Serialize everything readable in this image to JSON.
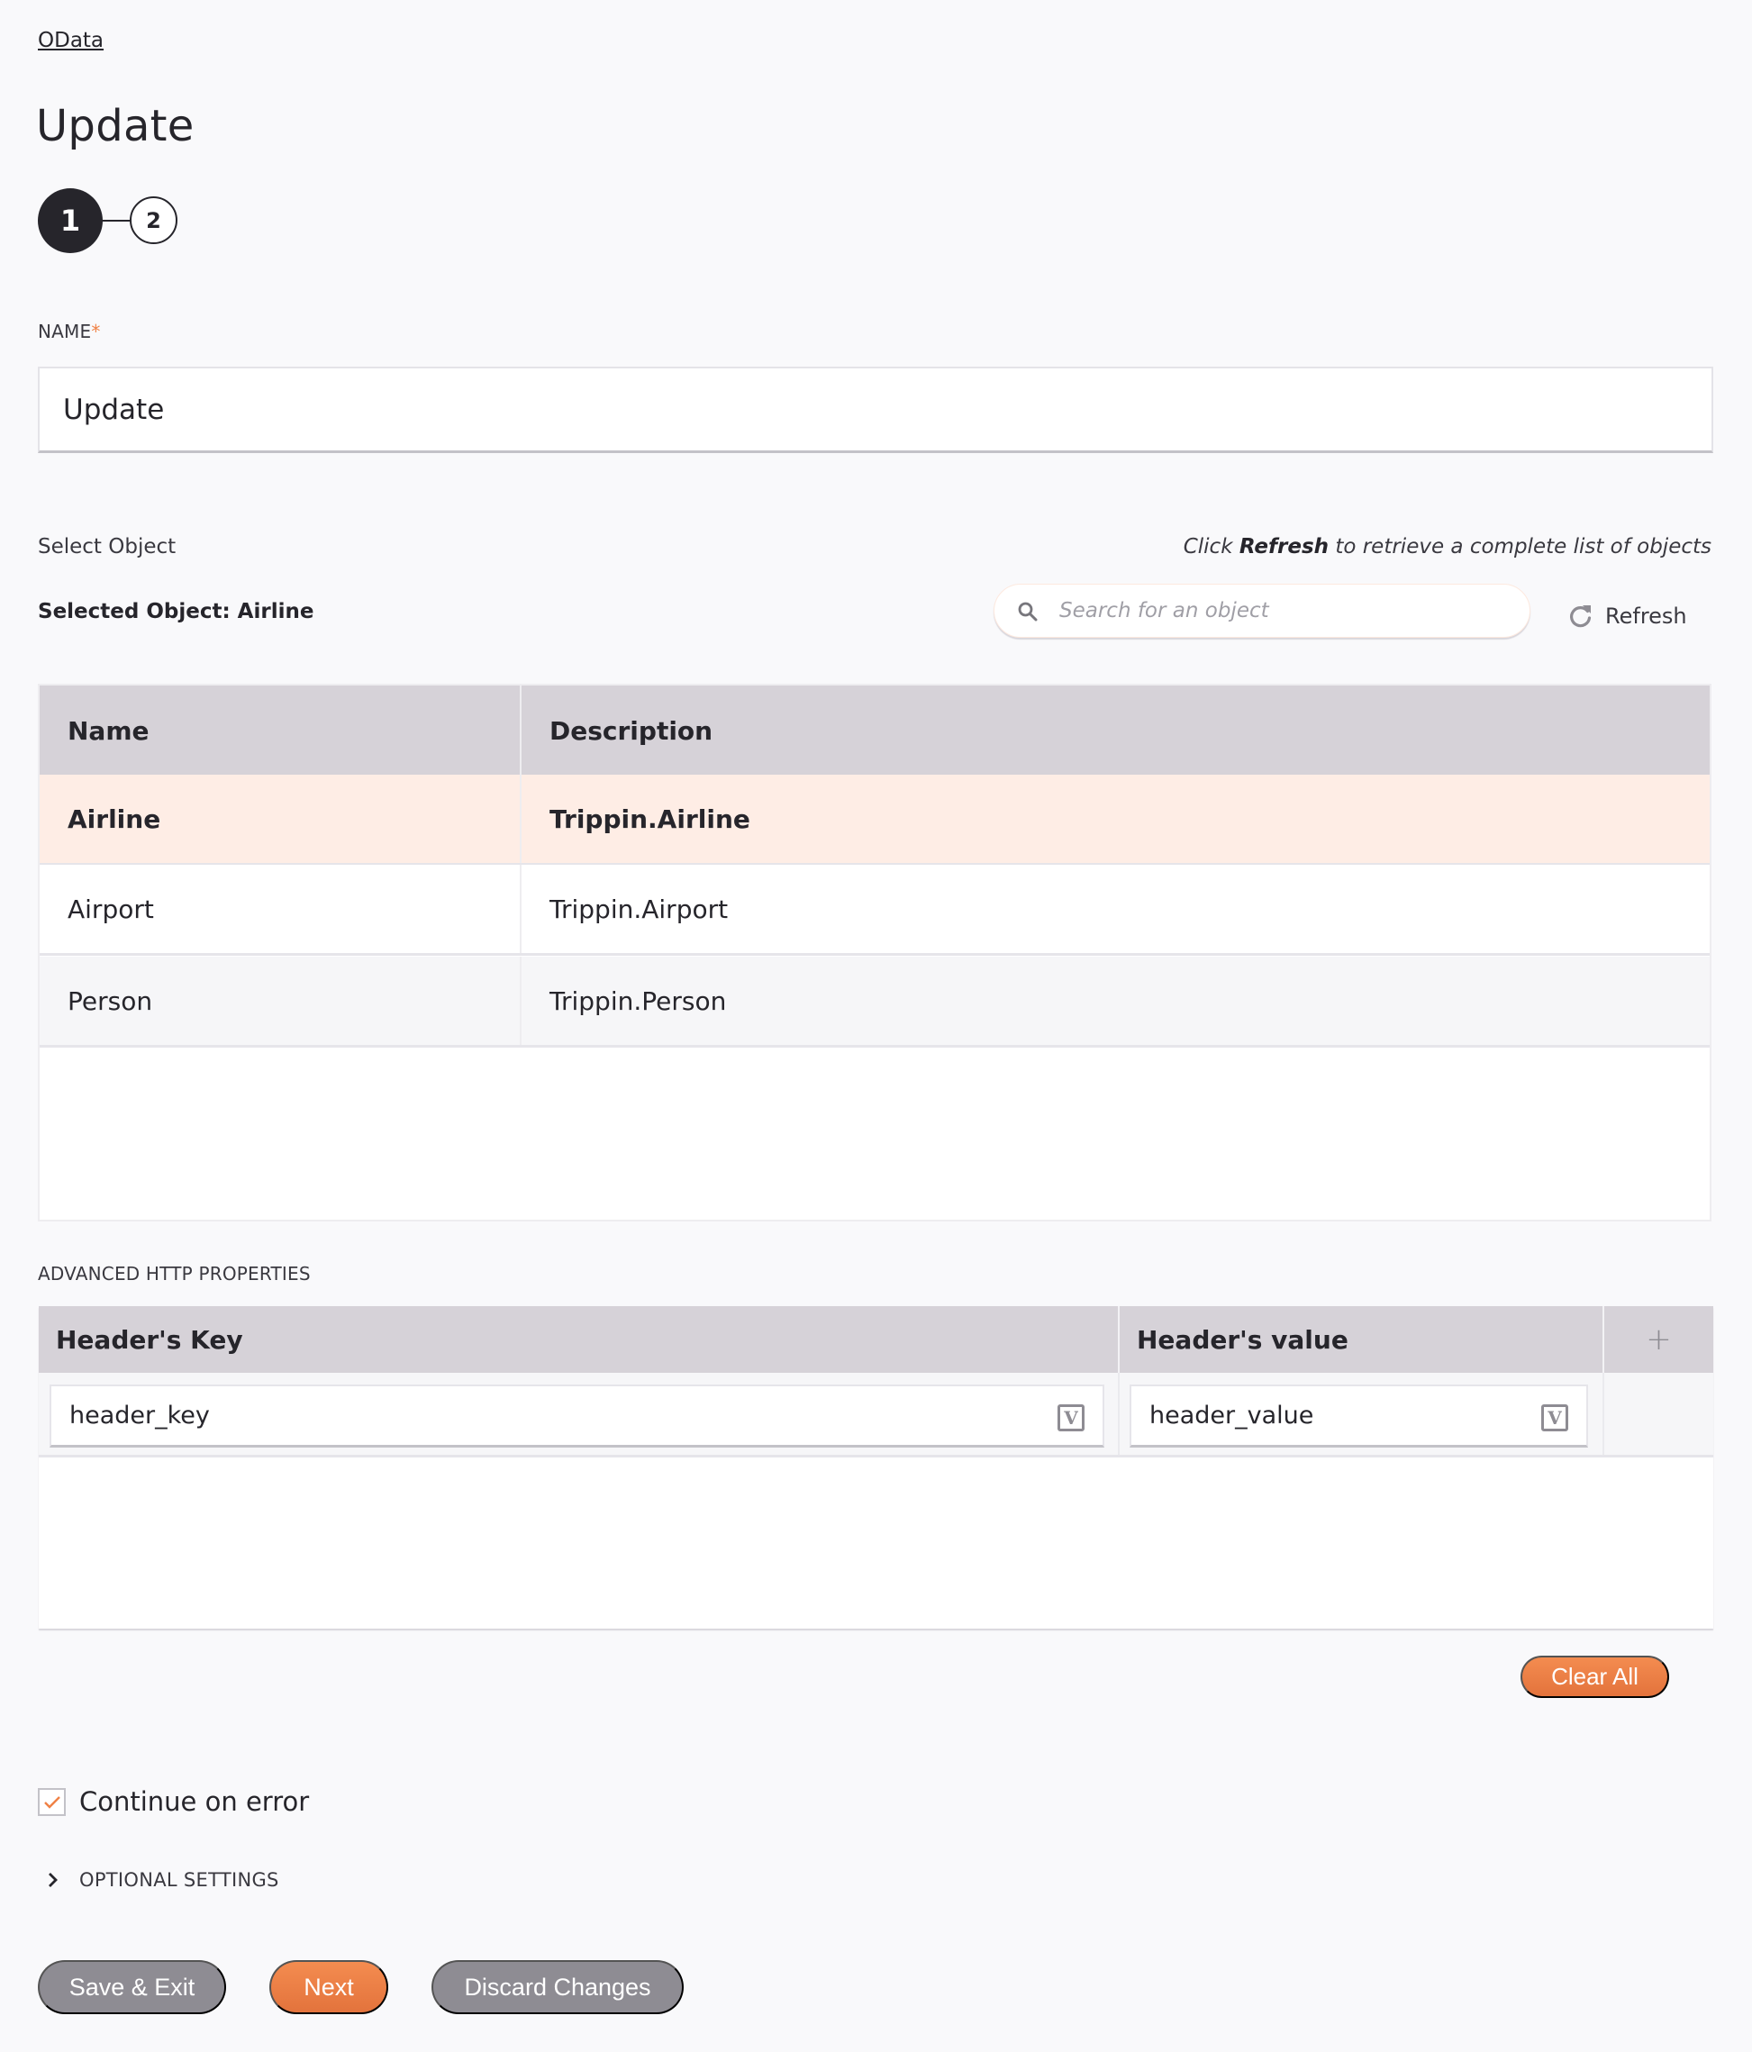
{
  "breadcrumb": "OData",
  "page_title": "Update",
  "stepper": {
    "steps": [
      "1",
      "2"
    ],
    "active_step": 1
  },
  "name_field": {
    "label": "NAME",
    "required_marker": "*",
    "value": "Update"
  },
  "select_object": {
    "label": "Select Object",
    "hint_prefix": "Click ",
    "hint_bold": "Refresh",
    "hint_suffix": " to retrieve a complete list of objects",
    "selected_text": "Selected Object: Airline",
    "search_placeholder": "Search for an object",
    "refresh_label": "Refresh"
  },
  "objects_table": {
    "columns": [
      "Name",
      "Description"
    ],
    "rows": [
      {
        "name": "Airline",
        "description": "Trippin.Airline",
        "selected": true
      },
      {
        "name": "Airport",
        "description": "Trippin.Airport",
        "selected": false
      },
      {
        "name": "Person",
        "description": "Trippin.Person",
        "selected": false
      }
    ]
  },
  "advanced_http": {
    "label": "ADVANCED HTTP PROPERTIES",
    "columns": [
      "Header's Key",
      "Header's value"
    ],
    "add_icon": "+",
    "rows": [
      {
        "key": "header_key",
        "value": "header_value"
      }
    ],
    "variable_icon_glyph": "V",
    "clear_all_label": "Clear All"
  },
  "continue_on_error": {
    "label": "Continue on error",
    "checked": true
  },
  "optional_settings": {
    "label": "OPTIONAL SETTINGS"
  },
  "footer": {
    "save_exit": "Save & Exit",
    "next": "Next",
    "discard": "Discard Changes"
  },
  "colors": {
    "accent": "#f08145",
    "header_bg": "#d6d2d8",
    "selected_row": "#feede5",
    "dark": "#26252b",
    "gray_button": "#8e8c93"
  }
}
